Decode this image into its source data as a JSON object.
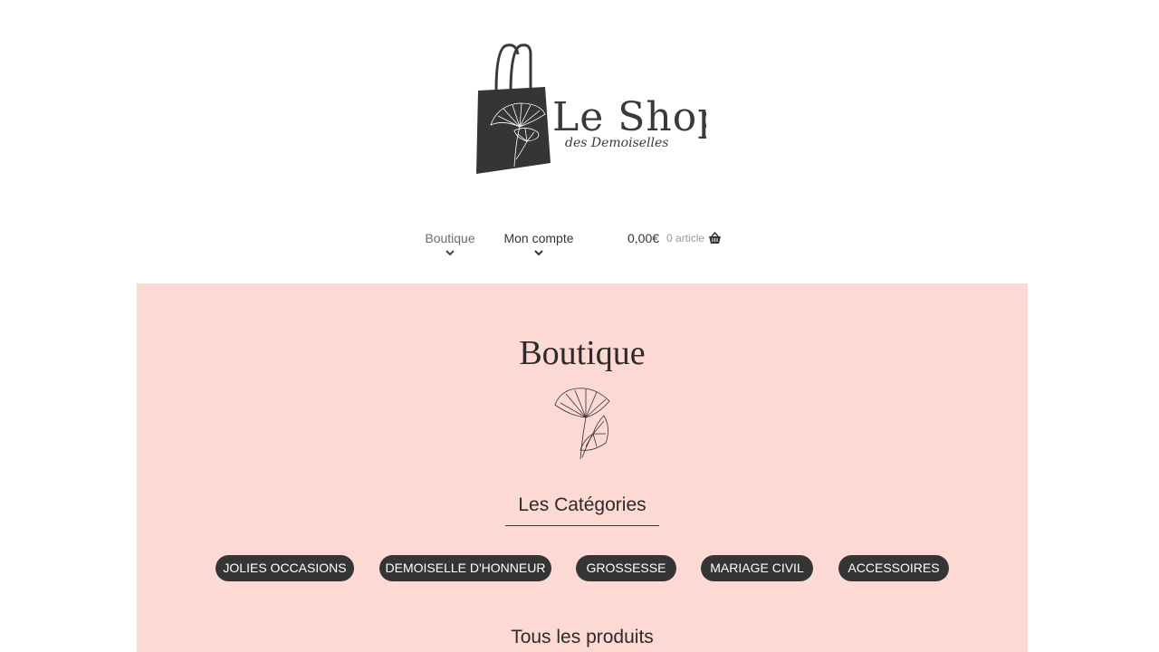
{
  "header": {
    "logo": {
      "wordmark": "Le Shop",
      "tagline": "des Demoiselles",
      "icon": "shopping-bag-ginkgo-logo"
    },
    "nav": {
      "items": [
        {
          "label": "Boutique",
          "icon": "chevron-down-icon"
        },
        {
          "label": "Mon compte",
          "icon": "chevron-down-icon"
        }
      ],
      "cart": {
        "amount": "0,00€",
        "count": "0 article",
        "icon": "basket-icon"
      }
    }
  },
  "main": {
    "title": "Boutique",
    "decoration_icon": "ginkgo-leaf-icon",
    "categories_title": "Les Catégories",
    "categories": [
      "JOLIES OCCASIONS",
      "DEMOISELLE D'HONNEUR",
      "GROSSESSE",
      "MARIAGE CIVIL",
      "ACCESSOIRES"
    ],
    "products_title": "Tous les produits"
  },
  "colors": {
    "content_background": "#fdd9d4",
    "pill_background": "#353535",
    "pill_text": "#ffffff",
    "text_dark": "#333333",
    "nav_muted": "#6d6d6d"
  }
}
